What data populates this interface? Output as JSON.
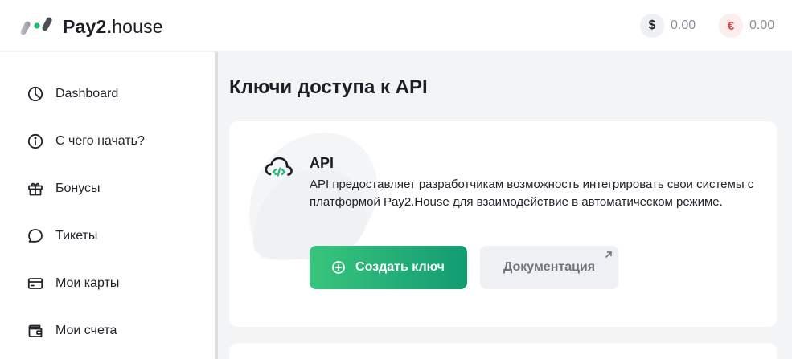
{
  "brand": {
    "name_bold": "Pay2.",
    "name_light": "house"
  },
  "balances": [
    {
      "currency_symbol": "$",
      "amount": "0.00",
      "color": "#1f2328"
    },
    {
      "currency_symbol": "€",
      "amount": "0.00",
      "color": "#e04848"
    }
  ],
  "sidebar": {
    "items": [
      {
        "label": "Dashboard",
        "icon": "pie-chart-icon"
      },
      {
        "label": "С чего начать?",
        "icon": "info-icon"
      },
      {
        "label": "Бонусы",
        "icon": "gift-icon"
      },
      {
        "label": "Тикеты",
        "icon": "chat-bubble-icon"
      },
      {
        "label": "Мои карты",
        "icon": "card-icon"
      },
      {
        "label": "Мои счета",
        "icon": "wallet-icon"
      }
    ]
  },
  "page": {
    "title": "Ключи доступа к API"
  },
  "api_card": {
    "icon": "cloud-code-icon",
    "title": "API",
    "description": "API предоставляет разработчикам возможность интегрировать свои системы с платформой Pay2.House для взаимодействие в автоматическом режиме.",
    "create_button_label": "Создать ключ",
    "docs_button_label": "Документация",
    "accent_color": "#119c72"
  }
}
